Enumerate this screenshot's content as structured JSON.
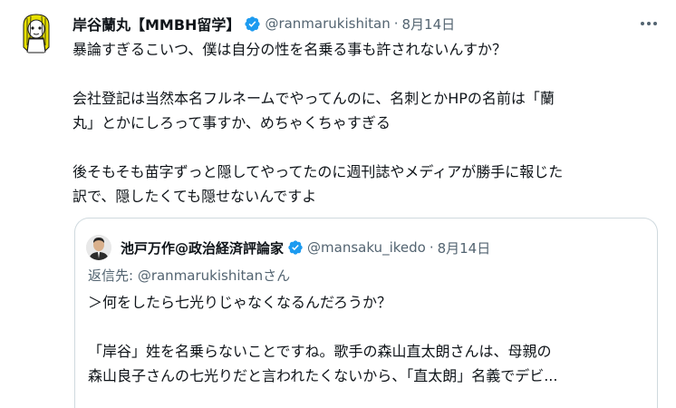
{
  "tweet": {
    "author": {
      "display_name": "岸谷蘭丸【MMBH留学】",
      "handle": "@ranmarukishitan",
      "avatar_icon": "cartoon-avatar-icon"
    },
    "dot": "·",
    "timestamp": "8月14日",
    "body": {
      "line1": "暴論すぎるこいつ、僕は自分の性を名乗る事も許されないんすか？",
      "line2": "会社登記は当然本名フルネームでやってんのに、名刺とかHPの名前は「蘭",
      "line3": "丸」とかにしろって事すか、めちゃくちゃすぎる",
      "line4": "後そもそも苗字ずっと隠してやってたのに週刊誌やメディアが勝手に報じた",
      "line5": "訳で、隠したくても隠せないんですよ"
    },
    "quoted": {
      "author": {
        "display_name": "池戸万作@政治経済評論家",
        "handle": "@mansaku_ikedo"
      },
      "dot": "·",
      "timestamp": "8月14日",
      "reply_prefix": "返信先: ",
      "reply_handle": "@ranmarukishitan",
      "reply_suffix": "さん",
      "body": {
        "line1": "＞何をしたら七光りじゃなくなるんだろうか？",
        "line2": "「岸谷」姓を名乗らないことですね。歌手の森山直太朗さんは、母親の",
        "line3": "森山良子さんの七光りだと言われたくないから、「直太朗」名義でデビ..."
      }
    }
  },
  "colors": {
    "verified": "#1d9bf0",
    "secondary_text": "#536471",
    "border": "#cfd9de"
  }
}
